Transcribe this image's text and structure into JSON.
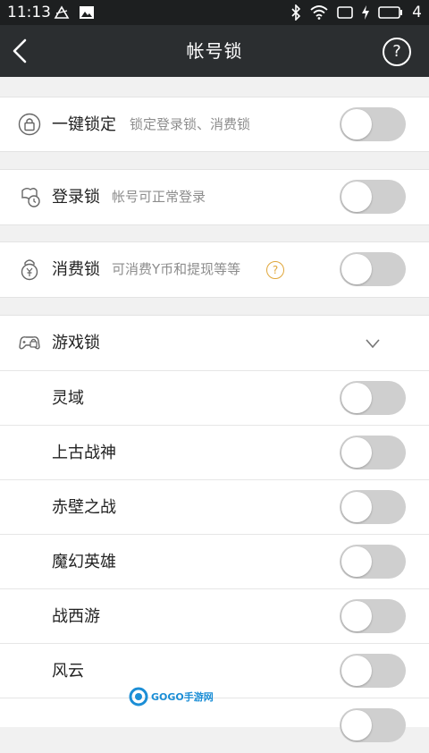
{
  "status_bar": {
    "time": "11:13",
    "battery_level": "4"
  },
  "app_bar": {
    "title": "帐号锁",
    "help_label": "?"
  },
  "locks": [
    {
      "icon": "lock-icon",
      "title": "一键锁定",
      "desc": "锁定登录锁、消费锁",
      "enabled": false
    },
    {
      "icon": "login-lock-icon",
      "title": "登录锁",
      "desc": "帐号可正常登录",
      "enabled": false
    },
    {
      "icon": "coin-lock-icon",
      "title": "消费锁",
      "desc": "可消费Y币和提现等等",
      "enabled": false,
      "help": "?"
    }
  ],
  "game_lock": {
    "icon": "gamepad-lock-icon",
    "title": "游戏锁",
    "games": [
      {
        "name": "灵域",
        "enabled": false
      },
      {
        "name": "上古战神",
        "enabled": false
      },
      {
        "name": "赤壁之战",
        "enabled": false
      },
      {
        "name": "魔幻英雄",
        "enabled": false
      },
      {
        "name": "战西游",
        "enabled": false
      },
      {
        "name": "风云",
        "enabled": false
      }
    ]
  },
  "watermark": {
    "text": "GOGO手游网"
  },
  "colors": {
    "app_bar": "#2b2e30",
    "status_bar": "#1d1f20",
    "toggle_off": "#cfcfcf",
    "help_accent": "#e0a63a",
    "watermark": "#1b8ed6"
  }
}
